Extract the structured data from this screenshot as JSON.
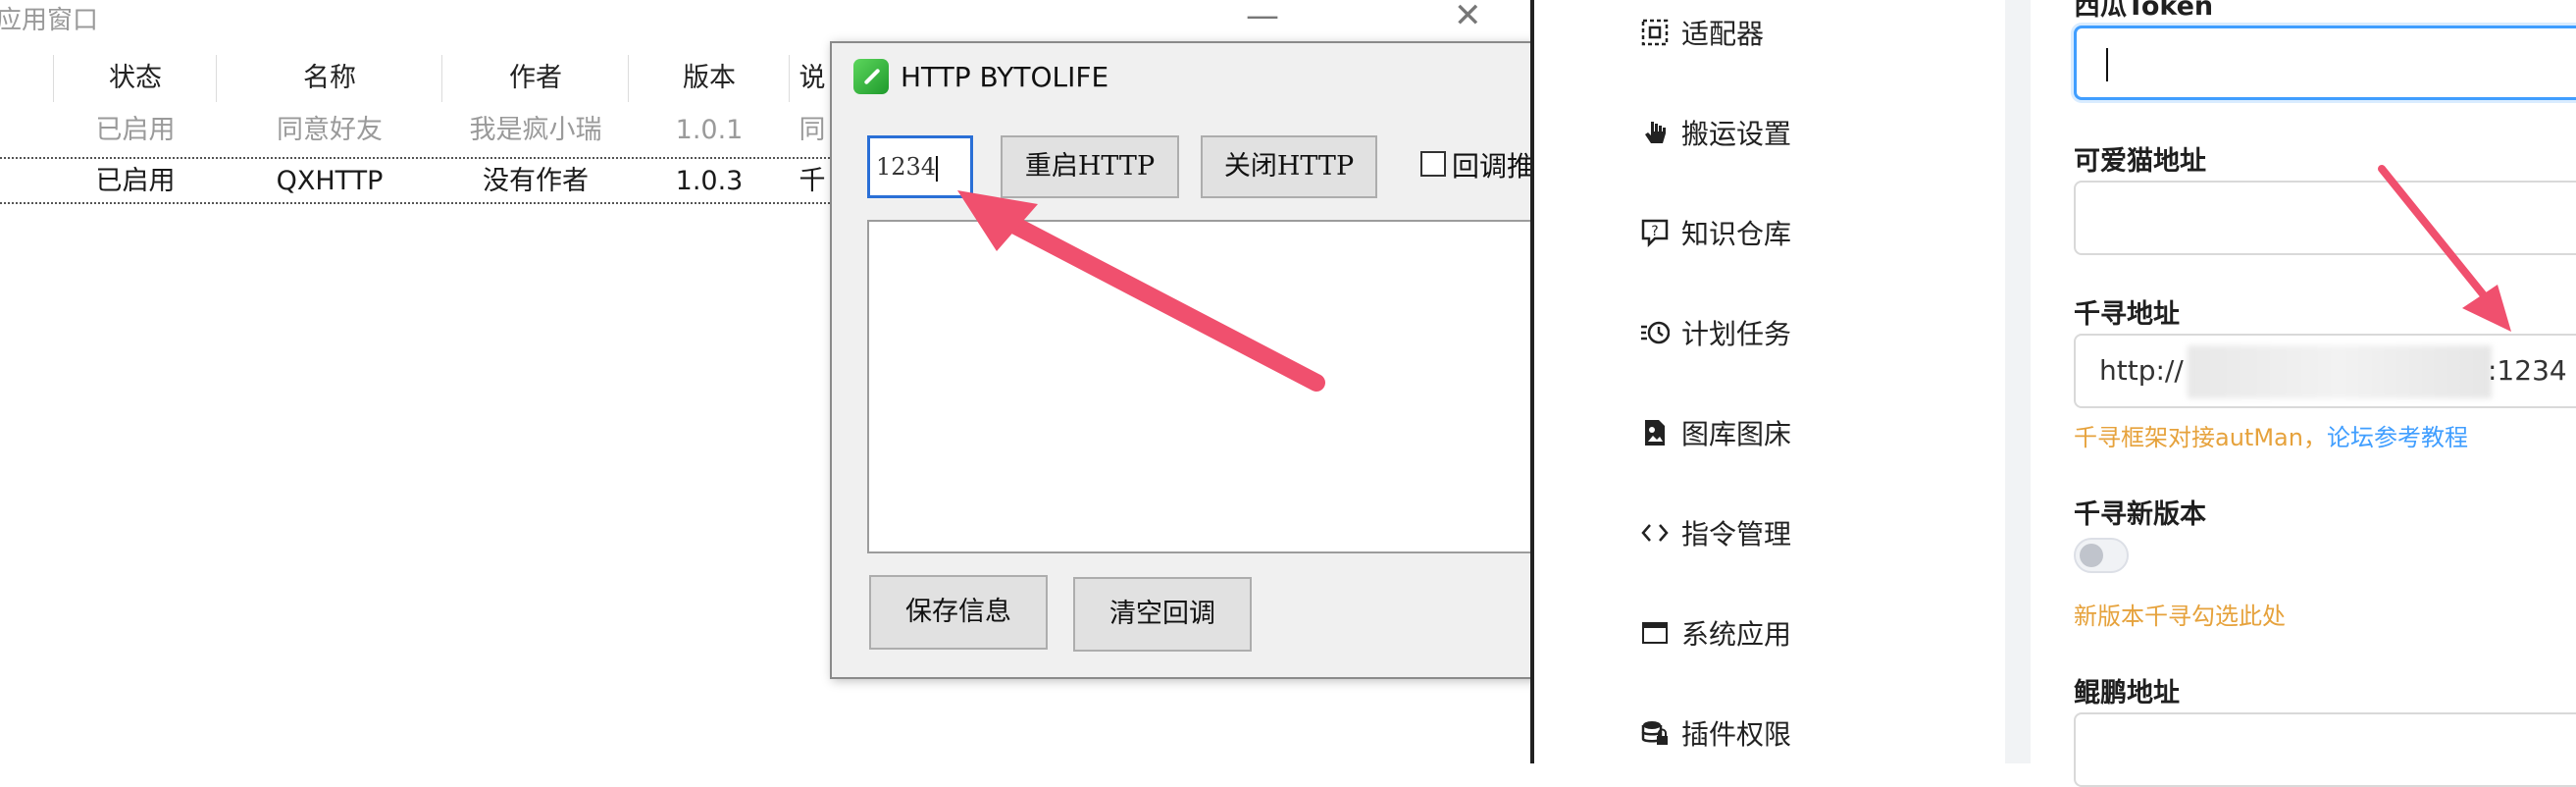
{
  "plugin_window": {
    "title": "应用窗口",
    "minimize_glyph": "—",
    "close_glyph": "✕",
    "columns": [
      "状态",
      "名称",
      "作者",
      "版本",
      "说"
    ],
    "rows": [
      {
        "status": "已启用",
        "name": "同意好友",
        "author": "我是疯小瑞",
        "version": "1.0.1",
        "desc": "同"
      },
      {
        "status": "已启用",
        "name": "QXHTTP",
        "author": "没有作者",
        "version": "1.0.3",
        "desc": "千"
      }
    ]
  },
  "http_dialog": {
    "title": "HTTP BYTOLIFE",
    "port_value": "1234",
    "restart_label": "重启HTTP",
    "close_label": "关闭HTTP",
    "callback_checkbox_label": "回调推",
    "save_label": "保存信息",
    "clear_label": "清空回调"
  },
  "autman": {
    "nav": [
      {
        "label": "适配器",
        "icon": "adapter-icon"
      },
      {
        "label": "搬运设置",
        "icon": "hand-icon"
      },
      {
        "label": "知识仓库",
        "icon": "question-chat-icon"
      },
      {
        "label": "计划任务",
        "icon": "schedule-clock-icon"
      },
      {
        "label": "图库图床",
        "icon": "image-file-icon"
      },
      {
        "label": "指令管理",
        "icon": "code-icon"
      },
      {
        "label": "系统应用",
        "icon": "window-icon"
      },
      {
        "label": "插件权限",
        "icon": "database-lock-icon"
      }
    ],
    "form": {
      "xigua_label": "西瓜Token",
      "xigua_value": "",
      "keaimao_label": "可爱猫地址",
      "keaimao_value": "",
      "qianxun_label": "千寻地址",
      "qianxun_value_prefix": "http://",
      "qianxun_value_suffix": ":1234",
      "qianxun_hint": "千寻框架对接autMan，",
      "qianxun_hint_link": "论坛参考教程",
      "qianxun_new_label": "千寻新版本",
      "qianxun_new_enabled": false,
      "qianxun_new_hint": "新版本千寻勾选此处",
      "kunpeng_label": "鲲鹏地址",
      "kunpeng_value": ""
    }
  },
  "colors": {
    "arrow": "#f0506e",
    "focus_blue": "#409eff",
    "hint_orange": "#e6a23c",
    "link_blue": "#409eff"
  }
}
